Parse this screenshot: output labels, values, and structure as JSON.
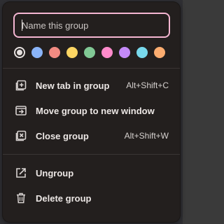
{
  "group_editor": {
    "name_placeholder": "Name this group",
    "name_value": ""
  },
  "colors": [
    {
      "name": "grey",
      "hex": "#e6e1df",
      "selected": true
    },
    {
      "name": "blue",
      "hex": "#8ab4f8",
      "selected": false
    },
    {
      "name": "red",
      "hex": "#f28b82",
      "selected": false
    },
    {
      "name": "yellow",
      "hex": "#fdd663",
      "selected": false
    },
    {
      "name": "green",
      "hex": "#81c995",
      "selected": false
    },
    {
      "name": "pink",
      "hex": "#ff8bcb",
      "selected": false
    },
    {
      "name": "purple",
      "hex": "#c58af9",
      "selected": false
    },
    {
      "name": "cyan",
      "hex": "#78d9ec",
      "selected": false
    },
    {
      "name": "orange",
      "hex": "#fcad70",
      "selected": false
    }
  ],
  "menu_items": [
    {
      "id": "new-tab",
      "label": "New tab in group",
      "shortcut": "Alt+Shift+C",
      "icon": "new-tab-icon"
    },
    {
      "id": "move-group",
      "label": "Move group to new window",
      "shortcut": "",
      "icon": "move-window-icon"
    },
    {
      "id": "close-group",
      "label": "Close group",
      "shortcut": "Alt+Shift+W",
      "icon": "close-group-icon"
    },
    {
      "id": "ungroup",
      "label": "Ungroup",
      "shortcut": "",
      "icon": "ungroup-icon"
    },
    {
      "id": "delete-group",
      "label": "Delete group",
      "shortcut": "",
      "icon": "trash-icon"
    }
  ],
  "theme": {
    "menu_bg": "#231f1e",
    "input_border": "#f4b6d2",
    "text": "#ece7e5"
  }
}
